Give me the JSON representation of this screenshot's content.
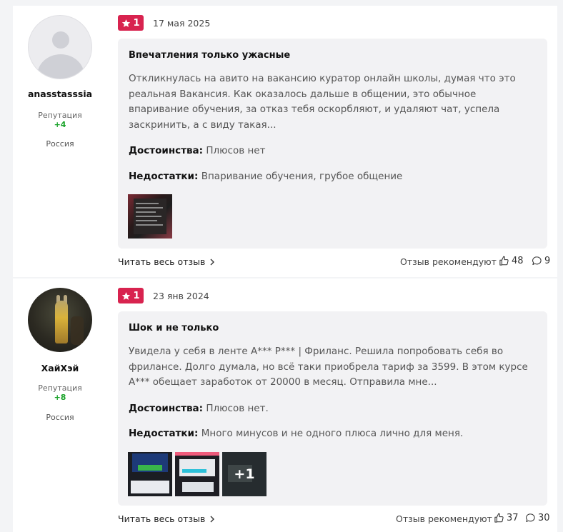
{
  "reviews": [
    {
      "author": {
        "name": "anasstasssia",
        "reputation_label": "Репутация",
        "reputation_value": "+4",
        "country": "Россия",
        "avatar": "user-placeholder-icon"
      },
      "rating": "1",
      "date": "17 мая 2025",
      "title": "Впечатления только ужасные",
      "text": "Откликнулась на авито на вакансию куратор онлайн школы, думая что это реальная Вакансия. Как оказалось дальше в общении, это обычное впаривание обучения, за отказ тебя оскорбляют, и удаляют чат, успела заскринить, а с виду такая...",
      "pros_label": "Достоинства:",
      "pros": "Плюсов нет",
      "cons_label": "Недостатки:",
      "cons": "Впаривание обучения, грубое общение",
      "read_more": "Читать весь отзыв",
      "recommend_label": "Отзыв рекомендуют",
      "likes": "48",
      "comments": "9"
    },
    {
      "author": {
        "name": "ХайХэй",
        "reputation_label": "Репутация",
        "reputation_value": "+8",
        "country": "Россия",
        "avatar": "user-photo"
      },
      "rating": "1",
      "date": "23 янв 2024",
      "title": "Шок и не только",
      "text": "Увидела у себя в ленте А*** Р*** | Фриланс. Решила попробовать себя во фрилансе. Долго думала, но всё таки приобрела тариф за 3599. В этом курсе А*** обещает заработок от 20000 в месяц. Отправила мне...",
      "pros_label": "Достоинства:",
      "pros": "Плюсов нет.",
      "cons_label": "Недостатки:",
      "cons": "Много минусов и не одного плюса лично для меня.",
      "more_images": "+1",
      "read_more": "Читать весь отзыв",
      "recommend_label": "Отзыв рекомендуют",
      "likes": "37",
      "comments": "30"
    }
  ],
  "colors": {
    "rating_badge": "#d8234f",
    "reputation": "#1aa32a",
    "content_bg": "#f2f2f4"
  }
}
